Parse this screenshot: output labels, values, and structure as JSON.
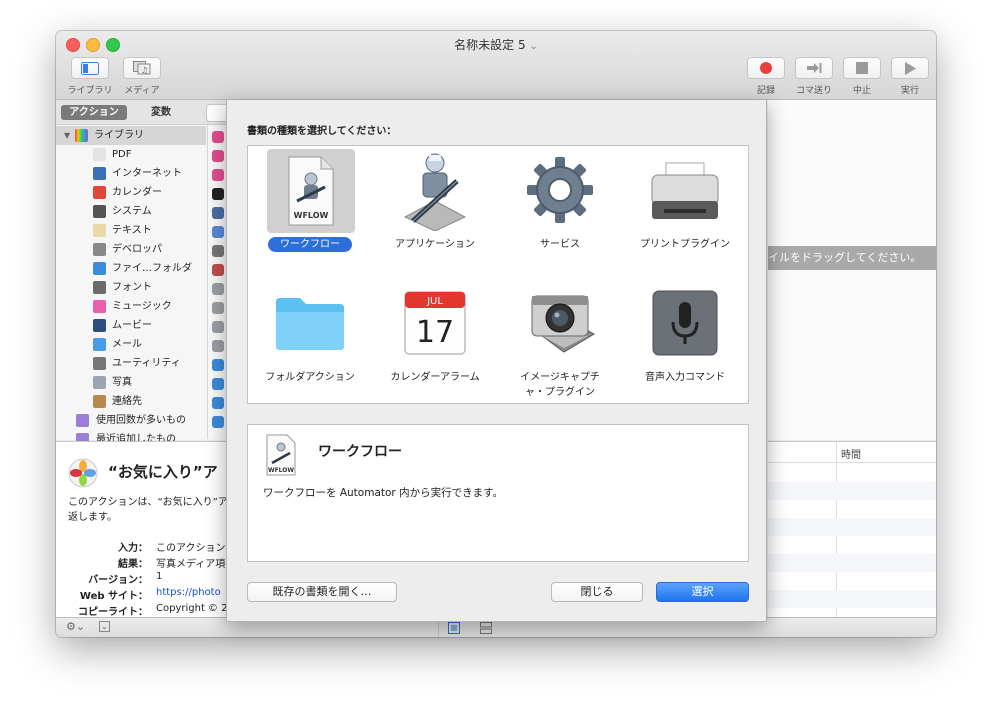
{
  "window": {
    "title": "名称未設定 5",
    "title_chevron": "⌄"
  },
  "toolbar": {
    "library_label": "ライブラリ",
    "media_label": "メディア",
    "record_label": "記録",
    "step_label": "コマ送り",
    "stop_label": "中止",
    "run_label": "実行"
  },
  "sidebar": {
    "tab_actions": "アクション",
    "tab_variables": "変数",
    "library_root": "ライブラリ",
    "items": [
      {
        "label": "PDF",
        "icon": "pdf-icon",
        "color": "#e3e3e3"
      },
      {
        "label": "インターネット",
        "icon": "globe-icon",
        "color": "#3a6fb8"
      },
      {
        "label": "カレンダー",
        "icon": "calendar-icon",
        "color": "#e2453c"
      },
      {
        "label": "システム",
        "icon": "system-icon",
        "color": "#555555"
      },
      {
        "label": "テキスト",
        "icon": "text-icon",
        "color": "#e9d9a6"
      },
      {
        "label": "デベロッパ",
        "icon": "developer-icon",
        "color": "#888888"
      },
      {
        "label": "ファイ…フォルダ",
        "icon": "finder-icon",
        "color": "#3d8bdb"
      },
      {
        "label": "フォント",
        "icon": "font-icon",
        "color": "#6b6b6b"
      },
      {
        "label": "ミュージック",
        "icon": "music-icon",
        "color": "#e85fae"
      },
      {
        "label": "ムービー",
        "icon": "movie-icon",
        "color": "#2b4e7e"
      },
      {
        "label": "メール",
        "icon": "mail-icon",
        "color": "#4a9be6"
      },
      {
        "label": "ユーティリティ",
        "icon": "utility-icon",
        "color": "#777777"
      },
      {
        "label": "写真",
        "icon": "photo-icon",
        "color": "#9aa5b1"
      },
      {
        "label": "連絡先",
        "icon": "contacts-icon",
        "color": "#b68a4e"
      }
    ],
    "smart_groups": [
      {
        "label": "使用回数が多いもの",
        "icon": "smart-folder-icon",
        "color": "#9b7fd6"
      },
      {
        "label": "最近追加したもの",
        "icon": "smart-folder-icon",
        "color": "#9b7fd6"
      }
    ]
  },
  "description": {
    "title": "“お気に入り”ア",
    "text_line1": "このアクションは、“お気に入り”ア",
    "text_line2": "返します。",
    "rows": [
      {
        "key": "入力：",
        "value": "このアクション"
      },
      {
        "key": "結果：",
        "value": "写真メディア項"
      },
      {
        "key": "バージョン：",
        "value": "1"
      },
      {
        "key": "Web サイト：",
        "value": "https://photo"
      },
      {
        "key": "コピーライト：",
        "value": "Copyright © 2"
      }
    ]
  },
  "workflow": {
    "drag_hint": "イルをドラッグしてください。",
    "log_column_time": "時間"
  },
  "sheet": {
    "prompt": "書類の種類を選択してください：",
    "types": [
      {
        "label": "ワークフロー",
        "icon": "wflow-document-icon",
        "selected": true
      },
      {
        "label": "アプリケーション",
        "icon": "automator-robot-icon",
        "selected": false
      },
      {
        "label": "サービス",
        "icon": "gear-icon",
        "selected": false
      },
      {
        "label": "プリントプラグイン",
        "icon": "printer-icon",
        "selected": false
      },
      {
        "label": "フォルダアクション",
        "icon": "folder-icon",
        "selected": false
      },
      {
        "label": "カレンダーアラーム",
        "icon": "calendar-icon",
        "selected": false
      },
      {
        "label": "イメージキャプチャ・プラグイン",
        "label_line1": "イメージキャプチ",
        "label_line2": "ャ・プラグイン",
        "icon": "camera-icon",
        "selected": false
      },
      {
        "label": "音声入力コマンド",
        "icon": "microphone-icon",
        "selected": false
      }
    ],
    "wflow_badge": "WFLOW",
    "calendar_month": "JUL",
    "calendar_day": "17",
    "detail_title": "ワークフロー",
    "detail_text": "ワークフローを Automator 内から実行できます。",
    "open_existing_button": "既存の書類を開く…",
    "close_button": "閉じる",
    "choose_button": "選択"
  }
}
